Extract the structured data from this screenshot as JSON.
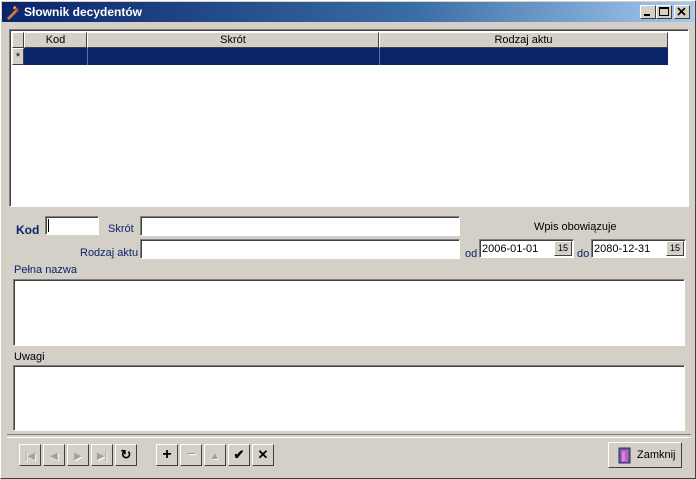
{
  "window": {
    "title": "Słownik decydentów"
  },
  "grid": {
    "columns": [
      "Kod",
      "Skrót",
      "Rodzaj aktu"
    ],
    "row_marker": "*"
  },
  "form": {
    "kod_label": "Kod",
    "kod_value": "",
    "skrot_label": "Skrót",
    "skrot_value": "",
    "rodzaj_label": "Rodzaj aktu",
    "rodzaj_value": "",
    "wpis_label": "Wpis obowiązuje",
    "od_label": "od",
    "od_value": "2006-01-01",
    "do_label": "do",
    "do_value": "2080-12-31",
    "cal_label": "15",
    "pelna_label": "Pełna nazwa",
    "pelna_value": "",
    "uwagi_label": "Uwagi",
    "uwagi_value": ""
  },
  "nav": {
    "first": "|◀",
    "prev": "◀",
    "next": "▶",
    "last": "▶|",
    "refresh": "↻",
    "add": "+",
    "delete": "−",
    "edit": "▲",
    "post": "✔",
    "cancel": "✕"
  },
  "close_button": "Zamknij",
  "colors": {
    "title_start": "#0a246a",
    "selection": "#0a246a",
    "face": "#d4d0c8",
    "label": "#0a246a"
  }
}
